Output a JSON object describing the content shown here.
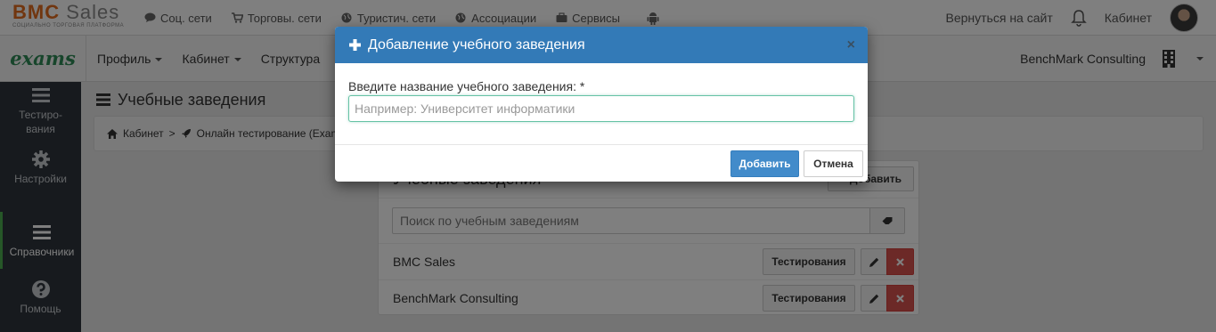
{
  "logo": {
    "part1": "BMC",
    "part2": "Sales",
    "tagline": "СОЦИАЛЬНО ТОРГОВАЯ ПЛАТФОРМА"
  },
  "topnav": [
    {
      "label": "Соц. сети",
      "icon": "comment-icon"
    },
    {
      "label": "Торговы. сети",
      "icon": "cart-icon"
    },
    {
      "label": "Туристич. сети",
      "icon": "globe-icon"
    },
    {
      "label": "Ассоциации",
      "icon": "globe-icon"
    },
    {
      "label": "Сервисы",
      "icon": "briefcase-icon"
    }
  ],
  "topright": {
    "back_label": "Вернуться на сайт",
    "cabinet_label": "Кабинет"
  },
  "brand": "exams",
  "secnav": {
    "profile": "Профиль",
    "cabinet": "Кабинет",
    "structure": "Структура"
  },
  "secright": {
    "company": "BenchMark Consulting"
  },
  "sidebar": {
    "items": [
      {
        "label": "Тестиро-\nвания",
        "icon": "menu-icon"
      },
      {
        "label": "Настройки",
        "icon": "gear-icon"
      },
      {
        "label": "Справочники",
        "icon": "menu-icon"
      },
      {
        "label": "Помощь",
        "icon": "question-icon"
      }
    ]
  },
  "page": {
    "title": "Учебные заведения"
  },
  "breadcrumb": {
    "home": "Кабинет",
    "current": "Онлайн тестирование (Exams)"
  },
  "panel": {
    "title": "Учебные заведения",
    "add_label": "Добавить",
    "search_placeholder": "Поиск по учебным заведениям",
    "rows": [
      {
        "name": "BMC Sales",
        "test_label": "Тестирования"
      },
      {
        "name": "BenchMark Consulting",
        "test_label": "Тестирования"
      }
    ]
  },
  "modal": {
    "title": "Добавление учебного заведения",
    "close": "×",
    "field_label": "Введите название учебного заведения: *",
    "field_placeholder": "Например: Университет информатики",
    "field_value": "",
    "submit_label": "Добавить",
    "cancel_label": "Отмена"
  },
  "colors": {
    "modal_header": "#337ab7",
    "primary": "#428bca",
    "danger": "#d9534f",
    "sidebar": "#2e353d",
    "brand_green": "#2e8b57"
  }
}
